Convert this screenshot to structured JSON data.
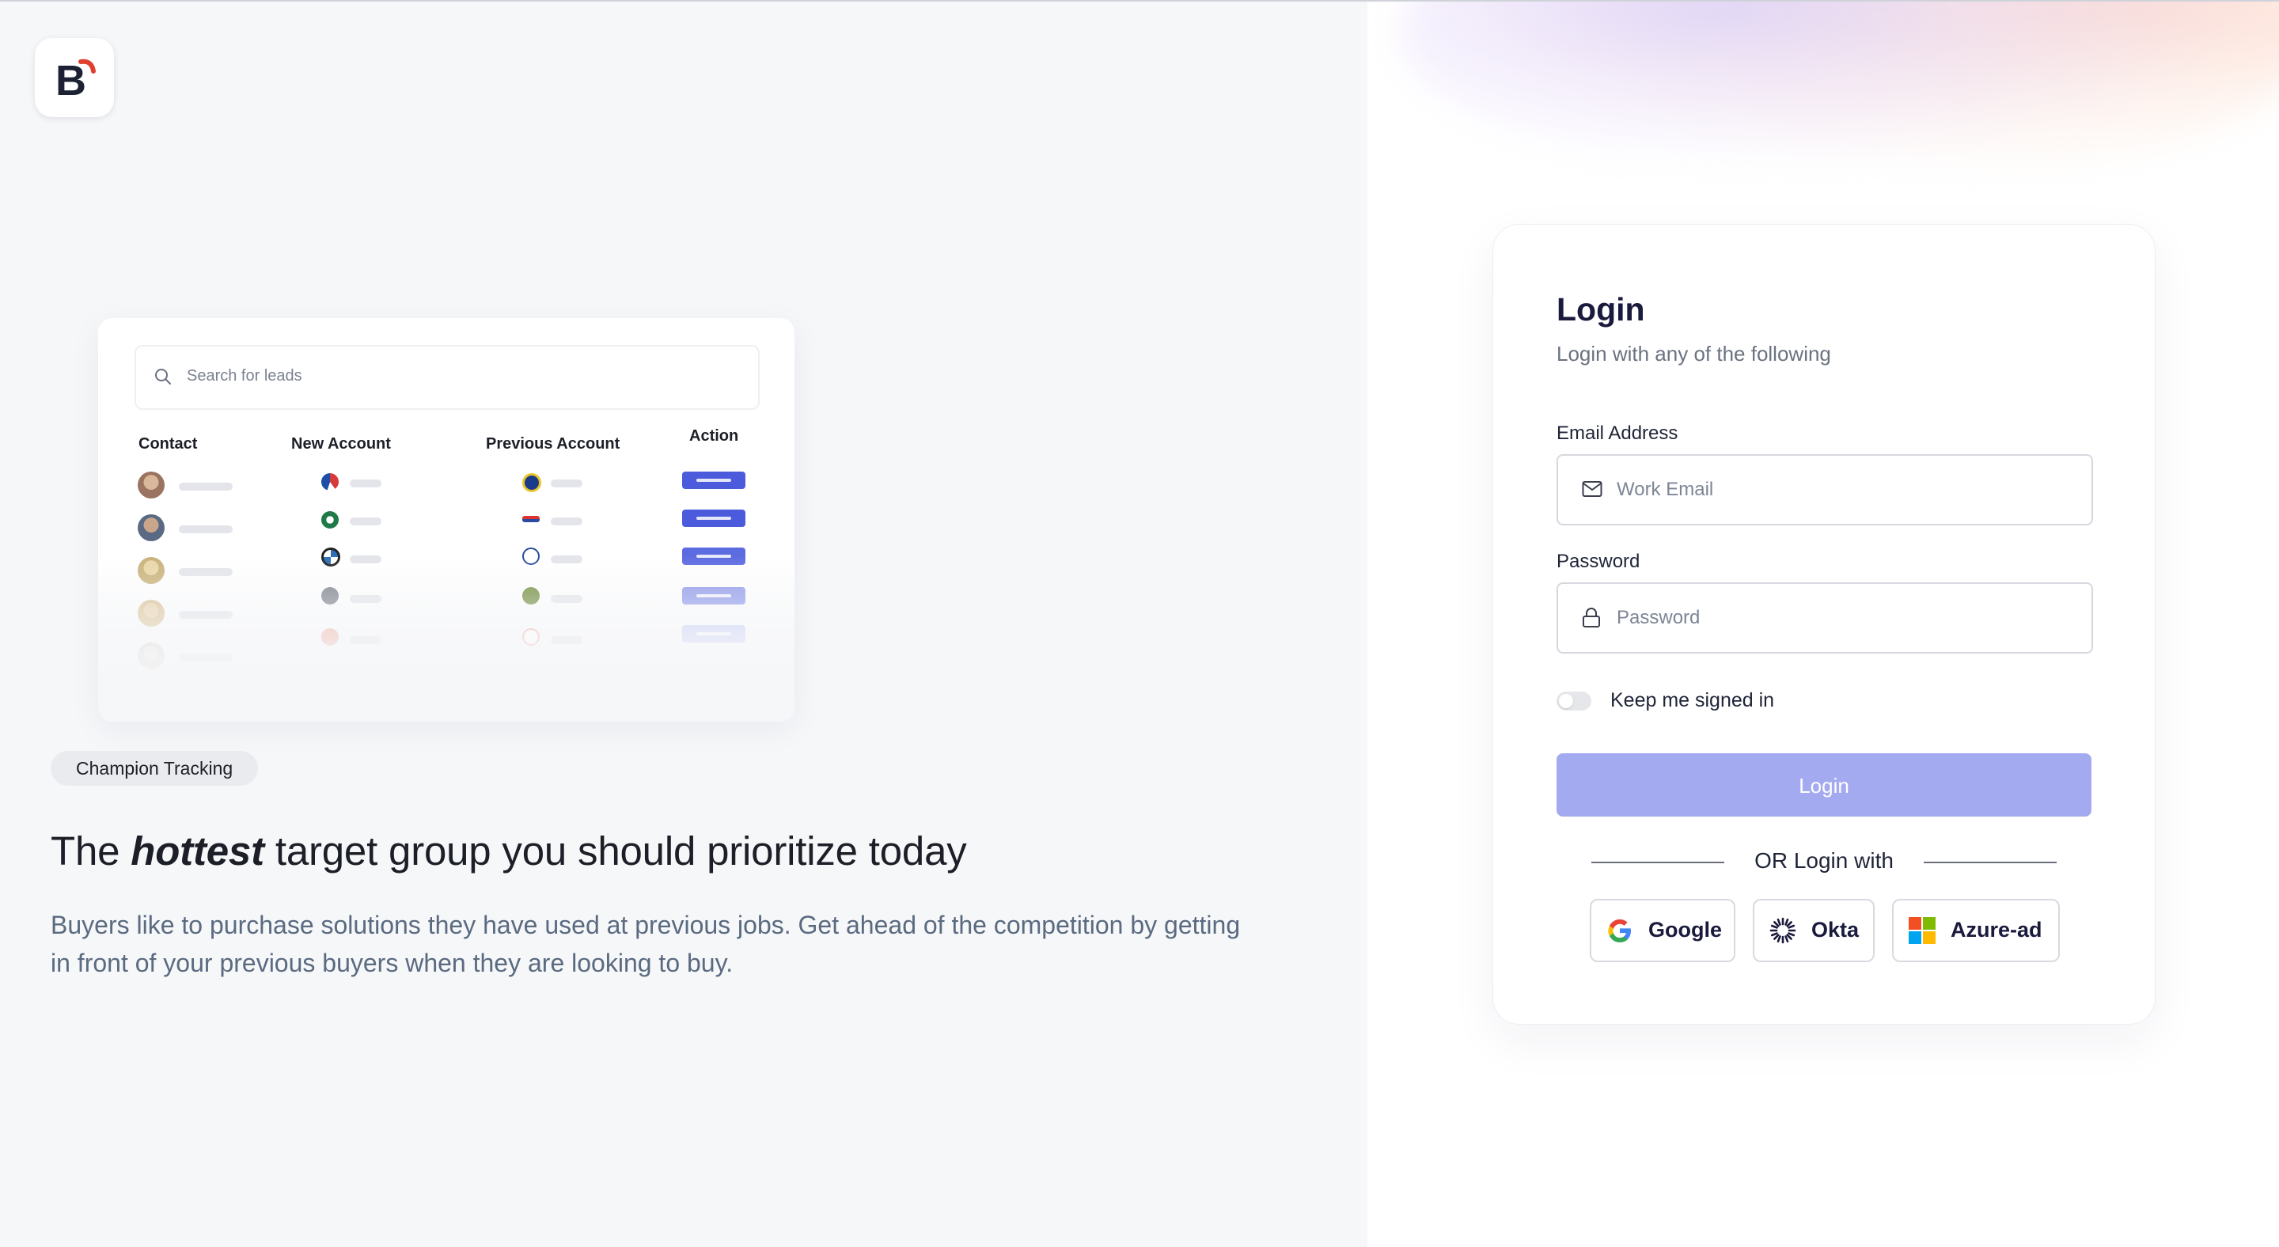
{
  "brand": {
    "logo_letter": "B",
    "logo_accent_color": "#e0402e",
    "logo_color": "#1c2233"
  },
  "preview": {
    "search_placeholder": "Search for leads",
    "columns": [
      "Contact",
      "New Account",
      "Previous Account",
      "Action"
    ],
    "action_color": "#4b5bdc"
  },
  "marketing": {
    "pill": "Champion Tracking",
    "headline_pre": "The",
    "headline_em": "hottest",
    "headline_post": "target group you should prioritize today",
    "description": "Buyers like to purchase solutions they have used at previous jobs. Get ahead of the competition by getting in front of your previous buyers when they are looking to buy."
  },
  "login": {
    "title": "Login",
    "subtitle": "Login with any of the following",
    "email_label": "Email Address",
    "email_placeholder": "Work Email",
    "email_icon": "mail-icon",
    "password_label": "Password",
    "password_placeholder": "Password",
    "password_icon": "lock-icon",
    "keep_signed_in": "Keep me signed in",
    "keep_signed_in_on": false,
    "button": "Login",
    "button_color": "#a4aaf0",
    "divider": "OR Login with",
    "providers": [
      {
        "label": "Google",
        "icon": "google-icon"
      },
      {
        "label": "Okta",
        "icon": "okta-icon"
      },
      {
        "label": "Azure-ad",
        "icon": "microsoft-icon"
      }
    ]
  }
}
